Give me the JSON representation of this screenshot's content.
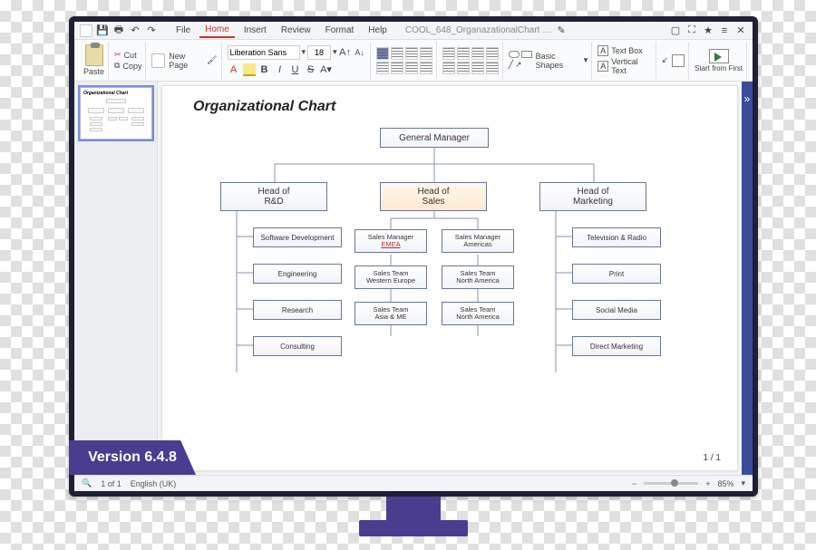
{
  "menubar": {
    "tabs": [
      "File",
      "Home",
      "Insert",
      "Review",
      "Format",
      "Help"
    ],
    "active_tab": "Home",
    "doc_name": "COOL_648_OrganazationalChart …"
  },
  "toolbar": {
    "paste": "Paste",
    "cut": "Cut",
    "copy": "Copy",
    "new_page": "New Page",
    "font_family": "Liberation Sans",
    "font_size": "18",
    "basic_shapes": "Basic Shapes",
    "text_box": "Text Box",
    "vertical_text": "Vertical Text",
    "start_first": "Start from First"
  },
  "document": {
    "title": "Organizational Chart",
    "page_indicator": "1 / 1"
  },
  "chart_data": {
    "type": "org-chart",
    "root": {
      "label": "General Manager"
    },
    "heads": [
      {
        "label_line1": "Head of",
        "label_line2": "R&D"
      },
      {
        "label_line1": "Head of",
        "label_line2": "Sales"
      },
      {
        "label_line1": "Head of",
        "label_line2": "Marketing"
      }
    ],
    "rd_children": [
      "Software Development",
      "Engineering",
      "Research",
      "Consulting"
    ],
    "sales_children_left": [
      {
        "l1": "Sales Manager",
        "l2": "EMEA"
      },
      {
        "l1": "Sales Team",
        "l2": "Western Europe"
      },
      {
        "l1": "Sales Team",
        "l2": "Asia & ME"
      }
    ],
    "sales_children_right": [
      {
        "l1": "Sales Manager",
        "l2": "Americas"
      },
      {
        "l1": "Sales Team",
        "l2": "North America"
      },
      {
        "l1": "Sales Team",
        "l2": "North America"
      }
    ],
    "marketing_children": [
      "Television & Radio",
      "Print",
      "Social Media",
      "Direct Marketing"
    ]
  },
  "statusbar": {
    "slide_count": "1 of 1",
    "language": "English (UK)",
    "zoom": "85%"
  },
  "version_badge": "Version 6.4.8"
}
